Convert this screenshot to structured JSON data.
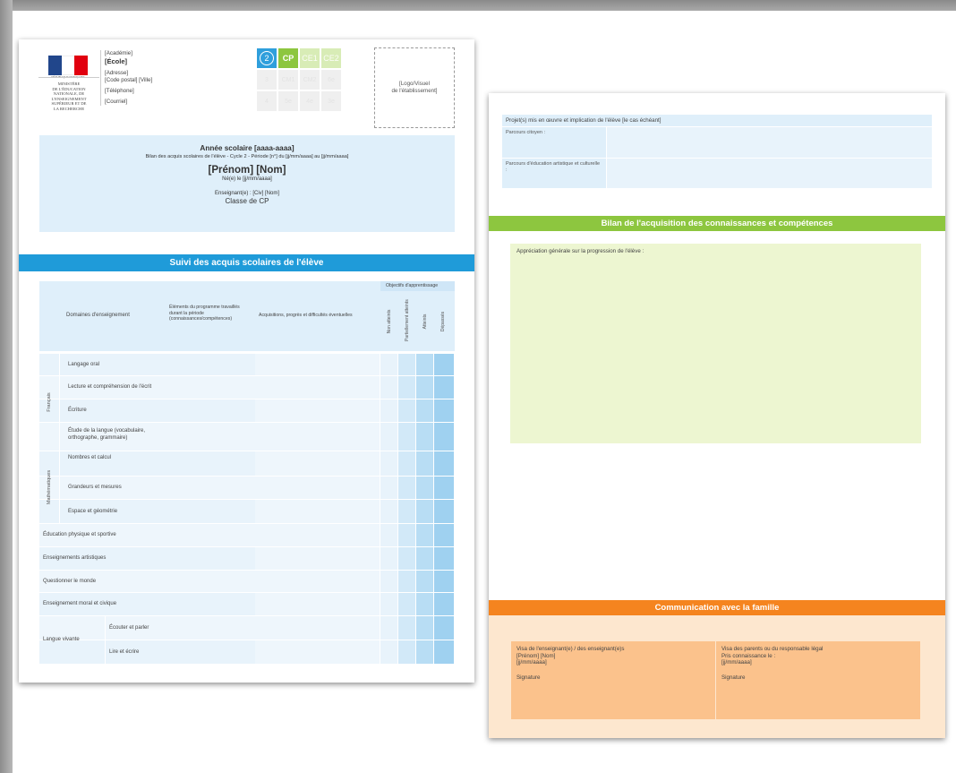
{
  "header": {
    "flag_colors": [
      "#21468b",
      "#ffffff",
      "#e1000f"
    ],
    "republic": "RÉPUBLIQUE FRANÇAISE",
    "ministry_lines": [
      "MINISTÈRE",
      "DE L'ÉDUCATION",
      "NATIONALE, DE",
      "L'ENSEIGNEMENT",
      "SUPÉRIEUR ET DE",
      "LA RECHERCHE"
    ],
    "academie": "[Académie]",
    "ecole": "[École]",
    "adresse": "[Adresse]",
    "code_postal": "[Code postal] [Ville]",
    "telephone": "[Téléphone]",
    "courriel": "[Courriel]",
    "logo_text_1": "[Logo/Visuel",
    "logo_text_2": "de l'établissement]"
  },
  "grade_selector": {
    "cycle": "2",
    "selected": "CP",
    "row1": [
      "CE1",
      "CE2"
    ],
    "row2": [
      "3",
      "CM1",
      "CM2",
      "6e"
    ],
    "row3": [
      "4",
      "5e",
      "4e",
      "3e"
    ]
  },
  "year_box": {
    "title": "Année scolaire [aaaa-aaaa]",
    "subtitle": "Bilan des acquis scolaires de l'élève - Cycle 2 - Période [n°] du [jj/mm/aaaa] au [jj/mm/aaaa]",
    "name": "[Prénom] [Nom]",
    "birth": "Né(e) le [jj/mm/aaaa]",
    "teacher": "Enseignant(e) : [Civ] [Nom]",
    "class": "Classe de CP"
  },
  "suivi": {
    "title": "Suivi des acquis scolaires de l'élève",
    "objectifs": "Objectifs d'apprentissage",
    "col_domaines": "Domaines d'enseignement",
    "col_elements": "Éléments du programme travaillés durant la période (connaissances/compétences)",
    "col_acquisitions": "Acquisitions, progrès et difficultés éventuelles",
    "levels": [
      "Non atteints",
      "Partiellement atteints",
      "Atteints",
      "Dépassés"
    ],
    "level_colors": [
      "#e8f3fb",
      "#d2e9f8",
      "#b8ddf4",
      "#9fd1f0"
    ],
    "group_francais": "Français",
    "group_maths": "Mathématiques",
    "group_langue": "Langue vivante",
    "francais_rows": [
      "Langage oral",
      "Lecture et compréhension de l'écrit",
      "Écriture",
      "Étude de la langue (vocabulaire, orthographe, grammaire)"
    ],
    "maths_rows": [
      "Nombres et calcul",
      "Grandeurs et mesures",
      "Espace et géométrie"
    ],
    "single_rows": [
      "Éducation physique et sportive",
      "Enseignements artistiques",
      "Questionner le monde",
      "Enseignement moral et civique"
    ],
    "langue_rows": [
      "Écouter et parler",
      "Lire et écrire"
    ]
  },
  "page2": {
    "projet_title": "Projet(s) mis en œuvre et implication de l'élève [le cas échéant]",
    "parcours_citoyen": "Parcours citoyen :",
    "parcours_education": "Parcours d'éducation artistique et culturelle :",
    "bilan_title": "Bilan de l'acquisition des connaissances et compétences",
    "appreciation": "Appréciation générale sur la progression de l'élève :",
    "comm_title": "Communication avec la famille",
    "visa_left": {
      "title": "Visa de l'enseignant(e) / des enseignant(e)s",
      "name": "[Prénom] [Nom]",
      "date": "[jj/mm/aaaa]",
      "signature": "Signature"
    },
    "visa_right": {
      "title": "Visa des parents ou du responsable légal",
      "pris": "Pris connaissance le :",
      "date": "[jj/mm/aaaa]",
      "signature": "Signature"
    }
  }
}
